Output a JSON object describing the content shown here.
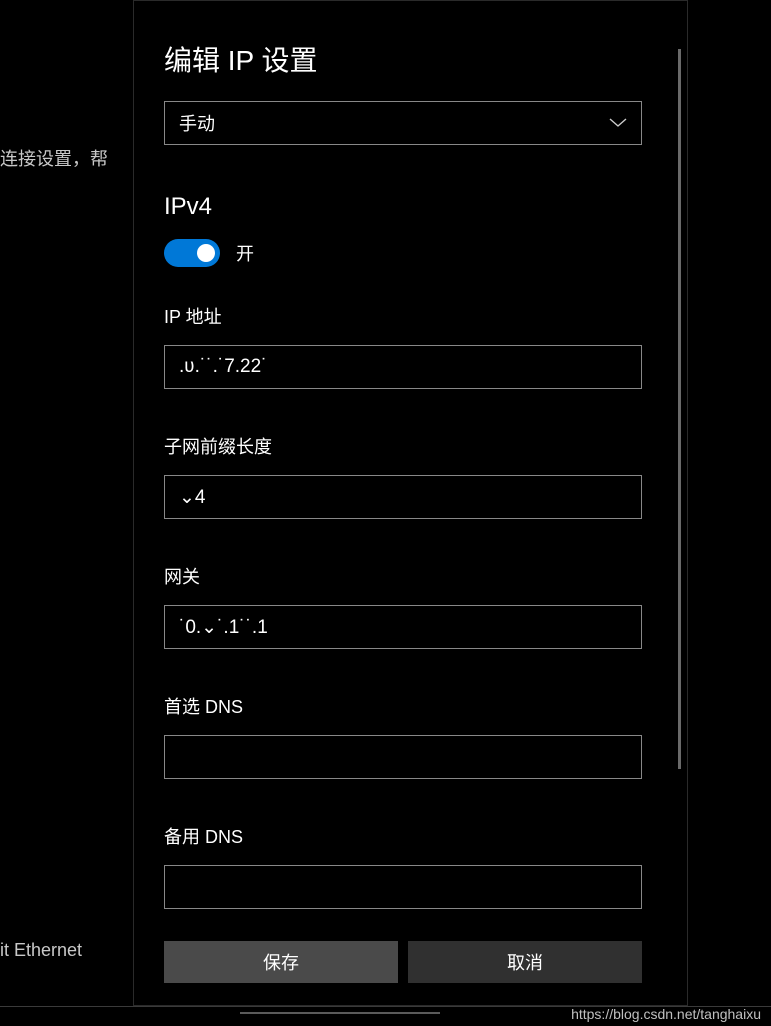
{
  "background": {
    "partial_text_top": "连接设置，帮",
    "partial_text_bottom": "it Ethernet"
  },
  "dialog": {
    "title": "编辑 IP 设置",
    "dropdown": {
      "selected": "手动"
    },
    "ipv4": {
      "header": "IPv4",
      "toggle_state": "开"
    },
    "fields": {
      "ip_address": {
        "label": "IP 地址",
        "value": ".ʋ.˙˙.˙7.22˙"
      },
      "subnet_prefix": {
        "label": "子网前缀长度",
        "value": "⌄4"
      },
      "gateway": {
        "label": "网关",
        "value": "˙0.⌄˙.1˙˙.1"
      },
      "preferred_dns": {
        "label": "首选 DNS",
        "value": ""
      },
      "alternate_dns": {
        "label": "备用 DNS",
        "value": ""
      }
    },
    "buttons": {
      "save": "保存",
      "cancel": "取消"
    }
  },
  "watermark": "https://blog.csdn.net/tanghaixu",
  "colors": {
    "accent": "#0078d7",
    "border": "#888888",
    "btn_primary": "#4a4a4a",
    "btn_secondary": "#303030"
  }
}
